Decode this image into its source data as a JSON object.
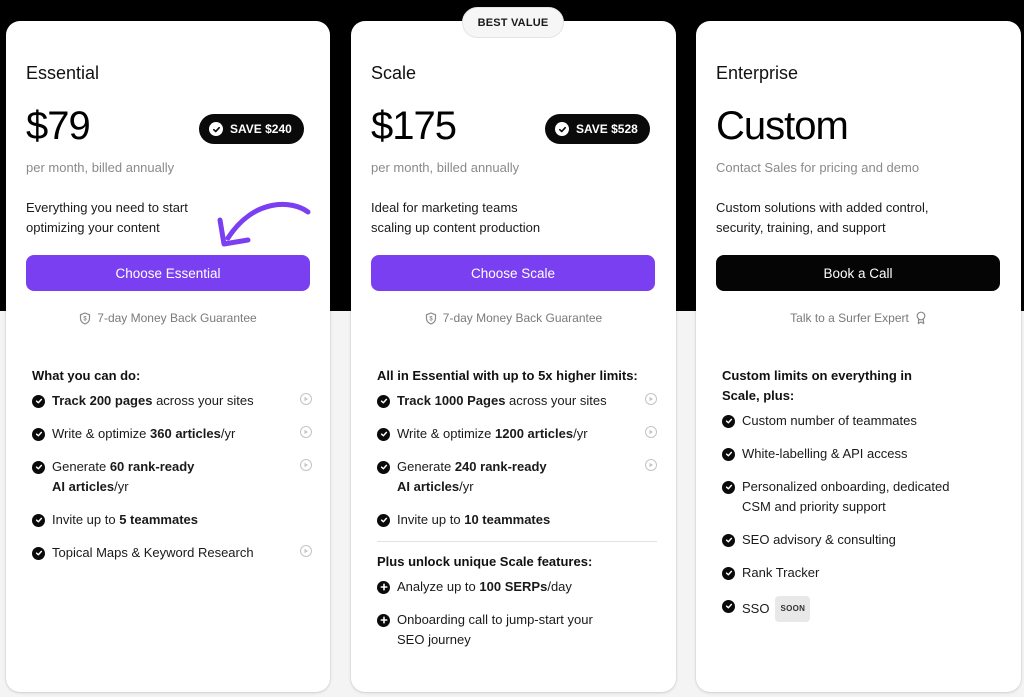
{
  "best_value_badge": "BEST VALUE",
  "accent_color": "#7b3ff2",
  "plans": [
    {
      "name": "Essential",
      "price": "$79",
      "save_badge": "SAVE $240",
      "billing": "per month, billed annually",
      "description_line1": "Everything you need to start",
      "description_line2": "optimizing your content",
      "cta": "Choose Essential",
      "footer_note": "7-day Money Back Guarantee",
      "footer_icon": "shield-dollar-icon",
      "features_heading": "What you can do:",
      "features": [
        {
          "pre": "",
          "bold": "Track 200 pages",
          "post": " across your sites",
          "pre2": "",
          "bold2": "",
          "post2": "",
          "has_play": true
        },
        {
          "pre": "Write & optimize ",
          "bold": "360 articles",
          "post": "/yr",
          "pre2": "",
          "bold2": "",
          "post2": "",
          "has_play": true
        },
        {
          "pre": "Generate ",
          "bold": "60 rank-ready",
          "post": "",
          "pre2": "",
          "bold2": "AI articles",
          "post2": "/yr",
          "has_play": true
        },
        {
          "pre": "Invite up to ",
          "bold": "5 teammates",
          "post": "",
          "pre2": "",
          "bold2": "",
          "post2": "",
          "has_play": false
        },
        {
          "pre": "Topical Maps & Keyword Research",
          "bold": "",
          "post": "",
          "pre2": "",
          "bold2": "",
          "post2": "",
          "has_play": true
        }
      ]
    },
    {
      "name": "Scale",
      "price": "$175",
      "save_badge": "SAVE $528",
      "billing": "per month, billed annually",
      "description_line1": "Ideal for marketing teams",
      "description_line2": "scaling up content production",
      "cta": "Choose Scale",
      "footer_note": "7-day Money Back Guarantee",
      "footer_icon": "shield-dollar-icon",
      "features_heading": "All in Essential with up to 5x higher limits:",
      "features": [
        {
          "pre": "",
          "bold": "Track 1000 Pages",
          "post": " across your sites",
          "pre2": "",
          "bold2": "",
          "post2": "",
          "has_play": true
        },
        {
          "pre": "Write & optimize ",
          "bold": "1200 articles",
          "post": "/yr",
          "pre2": "",
          "bold2": "",
          "post2": "",
          "has_play": true
        },
        {
          "pre": "Generate ",
          "bold": "240 rank-ready",
          "post": "",
          "pre2": "",
          "bold2": "AI articles",
          "post2": "/yr",
          "has_play": true
        },
        {
          "pre": "Invite up to ",
          "bold": "10 teammates",
          "post": "",
          "pre2": "",
          "bold2": "",
          "post2": "",
          "has_play": false
        }
      ],
      "extra_heading": "Plus unlock unique Scale features:",
      "extras": [
        {
          "pre": "Analyze up to ",
          "bold": "100 SERPs",
          "post": "/day",
          "line2": ""
        },
        {
          "pre": "Onboarding call to jump-start your",
          "bold": "",
          "post": "",
          "line2": "SEO journey"
        }
      ]
    },
    {
      "name": "Enterprise",
      "price": "Custom",
      "billing": "Contact Sales for pricing and demo",
      "description_line1": "Custom solutions with added control,",
      "description_line2": "security, training, and support",
      "cta": "Book a Call",
      "footer_note": "Talk to a Surfer Expert",
      "footer_icon": "award-ribbon-icon",
      "features_heading_line1": "Custom limits on everything in",
      "features_heading_line2": "Scale, plus:",
      "features": [
        {
          "text": "Custom number of teammates",
          "line2": ""
        },
        {
          "text": "White-labelling & API access",
          "line2": ""
        },
        {
          "text": "Personalized onboarding, dedicated",
          "line2": "CSM and priority support"
        },
        {
          "text": "SEO advisory & consulting",
          "line2": ""
        },
        {
          "text": "Rank Tracker",
          "line2": ""
        },
        {
          "text": "SSO",
          "line2": "",
          "badge": "SOON"
        }
      ]
    }
  ]
}
